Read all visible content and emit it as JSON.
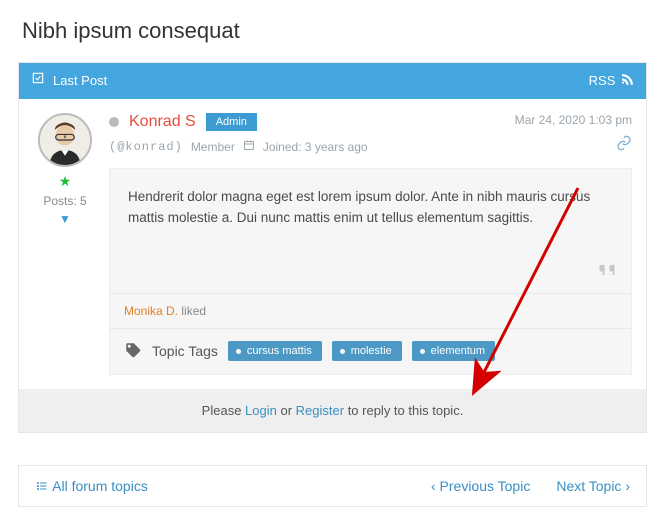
{
  "page_title": "Nibh ipsum consequat",
  "topbar": {
    "last_post": "Last Post",
    "rss": "RSS"
  },
  "post": {
    "status_dot": "offline",
    "author": "Konrad S",
    "role_badge": "Admin",
    "timestamp": "Mar 24, 2020 1:03 pm",
    "handle": "(@konrad)",
    "rank": "Member",
    "joined_label": "Joined:",
    "joined_value": "3 years ago",
    "side": {
      "posts_label": "Posts: 5"
    },
    "body": "Hendrerit dolor magna eget est lorem ipsum dolor. Ante in nibh mauris cursus mattis molestie a. Dui nunc mattis enim ut tellus elementum sagittis.",
    "liked_by": "Monika D.",
    "liked_suffix": " liked"
  },
  "tags": {
    "label": "Topic Tags",
    "items": [
      "cursus mattis",
      "molestie",
      "elementum"
    ]
  },
  "reply": {
    "prefix": "Please ",
    "login": "Login",
    "mid": " or ",
    "register": "Register",
    "suffix": " to reply to this topic."
  },
  "nav": {
    "all": "All forum topics",
    "prev": "Previous Topic",
    "next": "Next Topic"
  }
}
